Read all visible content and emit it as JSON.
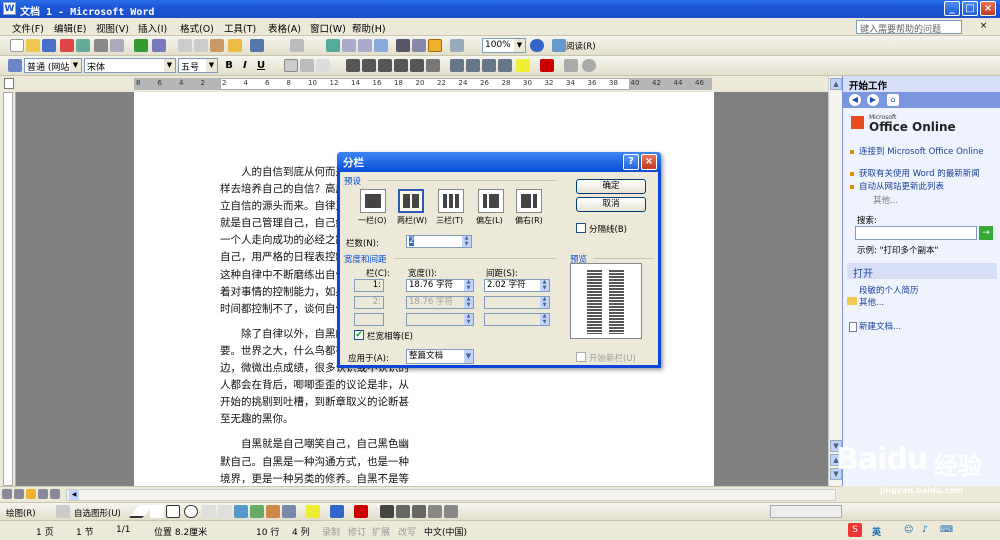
{
  "window": {
    "title": "文档 1 - Microsoft Word"
  },
  "menu": {
    "items": [
      "文件(F)",
      "编辑(E)",
      "视图(V)",
      "插入(I)",
      "格式(O)",
      "工具(T)",
      "表格(A)",
      "窗口(W)",
      "帮助(H)"
    ],
    "help_placeholder": "键入需要帮助的问题"
  },
  "toolbar": {
    "zoom": "100%",
    "read_label": "阅读(R)"
  },
  "format_toolbar": {
    "style": "普通 (网站)",
    "font": "宋体",
    "size": "五号",
    "bold": "B",
    "italic": "I",
    "underline": "U"
  },
  "ruler": {
    "ticks": [
      "8",
      "6",
      "4",
      "2",
      "2",
      "4",
      "6",
      "8",
      "10",
      "12",
      "14",
      "16",
      "18",
      "20",
      "22",
      "24",
      "26",
      "28",
      "30",
      "32",
      "34",
      "36",
      "38",
      "40",
      "42",
      "44",
      "46"
    ]
  },
  "document": {
    "paragraphs": [
      "人的自信到底从何而来？我们应该怎样去培养自己的自信？高度的自律，是建立自信的源头而来。自律又是什么？自律就是自己管理自己，自己约束自己。这是一个人走向成功的必经之路，先学会克制自己，用严格的日程表控制生活，才能在这种自律中不断磨练出自信。自信也代表着对事情的控制能力，如果你连最基本的时间都控制不了，谈何自信呢？",
      "除了自律以外，自黑的能力也非常重要。世界之大，什么鸟都有，在你的身边，微微出点成绩，很多认识或不认识的人都会在背后，唧唧歪歪的议论是非，从开始的挑剔到吐槽，到断章取义的论断甚至无趣的黑你。",
      "自黑就是自己嘲笑自己，自己黑色幽默自己。自黑是一种沟通方式，也是一种境界，更是一种另类的修养。自黑不是等到有人说你时才出现，而是从头到尾都需要有的能力。你必须看透那些无聊恶俗的人，要比他们自己先懂得黑自己，待他们自知无趣后，便会让他们滚得远远的。"
    ]
  },
  "dialog": {
    "title": "分栏",
    "presets_label": "预设",
    "presets": [
      "一栏(O)",
      "两栏(W)",
      "三栏(T)",
      "偏左(L)",
      "偏右(R)"
    ],
    "ok": "确定",
    "cancel": "取消",
    "separator_label": "分隔线(B)",
    "num_columns_label": "栏数(N):",
    "num_columns": "2",
    "width_spacing_label": "宽度和间距",
    "col_header": "栏(C):",
    "width_header": "宽度(I):",
    "spacing_header": "间距(S):",
    "rows": [
      {
        "col": "1:",
        "width": "18.76 字符",
        "spacing": "2.02 字符"
      },
      {
        "col": "2:",
        "width": "18.76 字符",
        "spacing": ""
      },
      {
        "col": "",
        "width": "",
        "spacing": ""
      }
    ],
    "equal_width_label": "栏宽相等(E)",
    "preview_label": "预览",
    "apply_to_label": "应用于(A):",
    "apply_to": "整篇文档",
    "new_column_label": "开始新栏(U)"
  },
  "taskpane": {
    "title": "开始工作",
    "logo_small": "Microsoft",
    "logo": "Office Online",
    "links": [
      "连接到 Microsoft Office Online",
      "获取有关使用 Word 的最新新闻",
      "自动从网站更新此列表"
    ],
    "more": "其他...",
    "search_label": "搜索:",
    "example": "示例: \"打印多个副本\"",
    "open_section": "打开",
    "open_items": [
      "段敏的个人简历",
      "其他..."
    ],
    "new_doc": "新建文档..."
  },
  "drawbar": {
    "draw": "绘图(R)",
    "autoshapes": "自选图形(U)"
  },
  "status": {
    "page": "1 页",
    "section": "1 节",
    "pages": "1/1",
    "position": "位置 8.2厘米",
    "line": "10 行",
    "col": "4 列",
    "rec": "录制",
    "trk": "修订",
    "ext": "扩展",
    "ovr": "改写",
    "lang": "中文(中国)"
  },
  "watermark": {
    "brand": "Baidu",
    "cn": "经验",
    "url": "jingyan.baidu.com"
  },
  "ime": {
    "mode": "英"
  }
}
